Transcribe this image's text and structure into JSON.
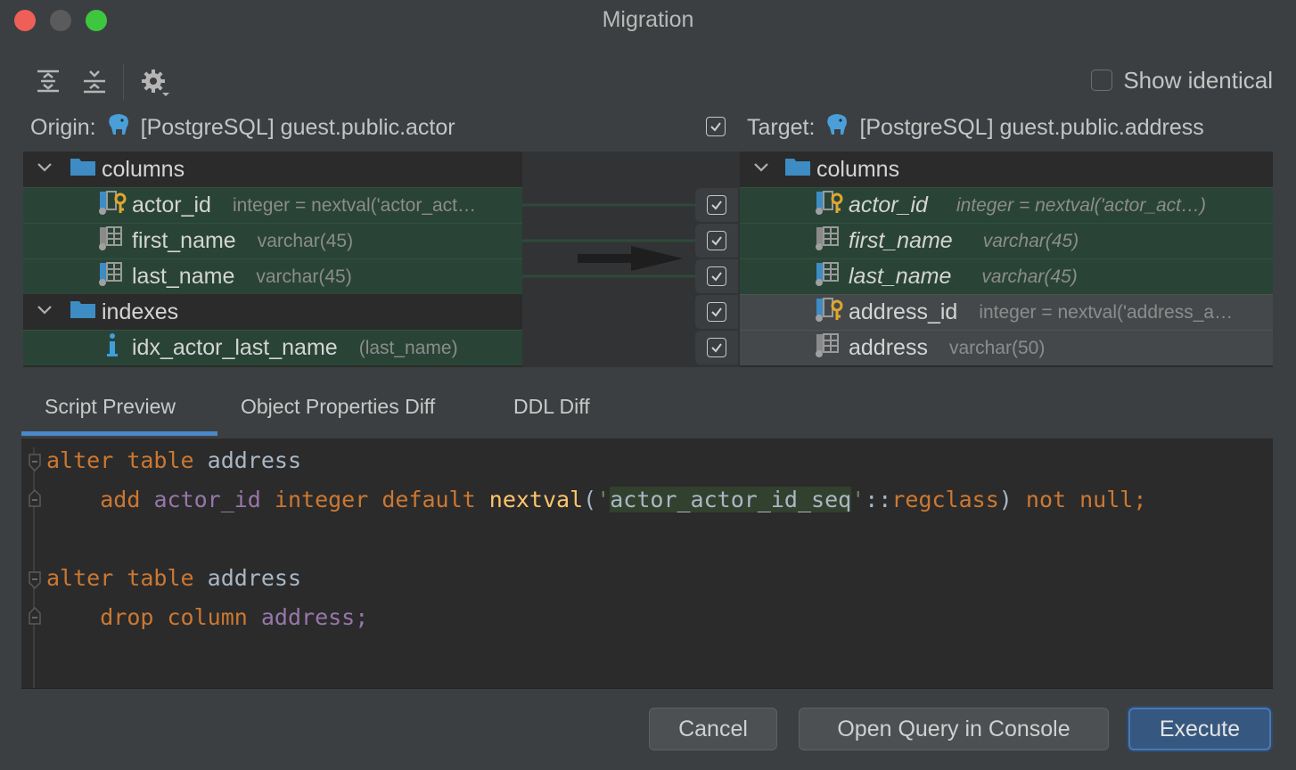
{
  "window": {
    "title": "Migration"
  },
  "toolbar": {
    "expand_icon": "expand-all-icon",
    "collapse_icon": "collapse-all-icon",
    "settings_icon": "gear-icon",
    "show_identical_label": "Show identical",
    "show_identical_checked": false
  },
  "origin": {
    "label": "Origin:",
    "source": "[PostgreSQL] guest.public.actor",
    "groups": [
      {
        "name": "columns",
        "items": [
          {
            "name": "actor_id",
            "type": "integer = nextval('actor_act…"
          },
          {
            "name": "first_name",
            "type": "varchar(45)"
          },
          {
            "name": "last_name",
            "type": "varchar(45)"
          }
        ]
      },
      {
        "name": "indexes",
        "items": [
          {
            "name": "idx_actor_last_name",
            "type": "(last_name)"
          }
        ]
      }
    ]
  },
  "target": {
    "label": "Target:",
    "source": "[PostgreSQL] guest.public.address",
    "groups": [
      {
        "name": "columns",
        "items": [
          {
            "name": "actor_id",
            "type": "integer  = nextval('actor_act…)"
          },
          {
            "name": "first_name",
            "type": "varchar(45)"
          },
          {
            "name": "last_name",
            "type": "varchar(45)"
          },
          {
            "name": "address_id",
            "type": "integer = nextval('address_a…"
          },
          {
            "name": "address",
            "type": "varchar(50)"
          }
        ]
      }
    ]
  },
  "tabs": [
    {
      "label": "Script Preview",
      "active": true
    },
    {
      "label": "Object Properties Diff",
      "active": false
    },
    {
      "label": "DDL Diff",
      "active": false
    }
  ],
  "script": {
    "l1": {
      "k1": "alter",
      "k2": "table",
      "t": "address"
    },
    "l2": {
      "k1": "add",
      "c": "actor_id",
      "k2": "integer",
      "k3": "default",
      "f": "nextval",
      "p1": "(",
      "q1": "'",
      "s": "actor_actor_id_seq",
      "q2": "'",
      "op": "::",
      "k4": "regclass",
      "p2": ")",
      "k5": "not",
      "k6": "null;"
    },
    "l3": {
      "k1": "alter",
      "k2": "table",
      "t": "address"
    },
    "l4": {
      "k1": "drop",
      "k2": "column",
      "c": "address;"
    }
  },
  "buttons": {
    "cancel": "Cancel",
    "open_console": "Open Query in Console",
    "execute": "Execute"
  },
  "colors": {
    "accent": "#4a88c7",
    "diff_green": "#294436",
    "diff_gray": "#45484a",
    "keyword": "#cc7832",
    "string": "#6a8759",
    "function": "#ffc66d",
    "column": "#9876aa"
  }
}
